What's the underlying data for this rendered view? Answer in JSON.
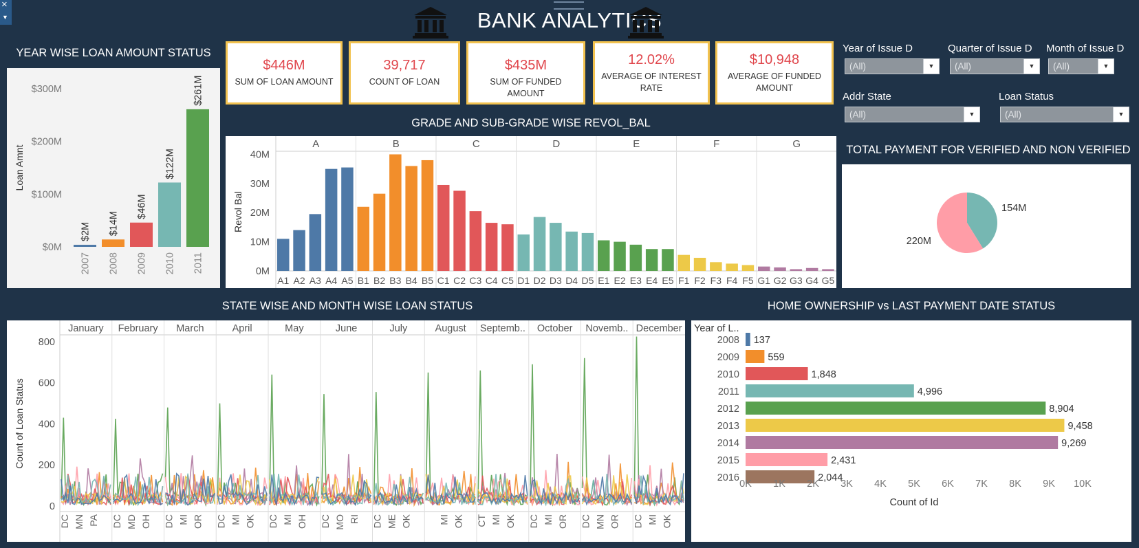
{
  "header": {
    "title": "BANK ANALYTICS"
  },
  "sections": {
    "year_loan": "YEAR WISE LOAN AMOUNT STATUS",
    "grade": "GRADE AND SUB-GRADE WISE REVOL_BAL",
    "verified": "TOTAL PAYMENT FOR VERIFIED AND NON VERIFIED",
    "state_month": "STATE WISE AND MONTH WISE LOAN STATUS",
    "home": "HOME OWNERSHIP vs LAST PAYMENT DATE STATUS"
  },
  "kpis": [
    {
      "value": "$446M",
      "label": "SUM OF LOAN AMOUNT"
    },
    {
      "value": "39,717",
      "label": "COUNT OF LOAN"
    },
    {
      "value": "$435M",
      "label": "SUM OF FUNDED AMOUNT"
    },
    {
      "value": "12.02%",
      "label": "AVERAGE OF INTEREST RATE"
    },
    {
      "value": "$10,948",
      "label": "AVERAGE OF FUNDED AMOUNT"
    }
  ],
  "filters": [
    {
      "label": "Year of Issue D",
      "value": "(All)"
    },
    {
      "label": "Quarter of Issue D",
      "value": "(All)"
    },
    {
      "label": "Month of Issue D",
      "value": "(All)"
    },
    {
      "label": "Addr State",
      "value": "(All)"
    },
    {
      "label": "Loan Status",
      "value": "(All)"
    }
  ],
  "colors": {
    "bg": "#1f3348",
    "blue": "#4e79a7",
    "orange": "#f28e2b",
    "red": "#e15759",
    "teal": "#76b7b2",
    "green": "#59a14f",
    "yellow": "#edc948",
    "purple": "#b07aa1",
    "pink": "#ff9da7",
    "brown": "#9c755f",
    "kpi_border": "#f2c24f",
    "kpi_value": "#e0464c"
  },
  "chart_data": [
    {
      "id": "year_loan",
      "type": "bar",
      "categories": [
        "2007",
        "2008",
        "2009",
        "2010",
        "2011"
      ],
      "values": [
        2,
        14,
        46,
        122,
        261
      ],
      "data_labels": [
        "$2M",
        "$14M",
        "$46M",
        "$122M",
        "$261M"
      ],
      "ylabel": "Loan Amnt",
      "y_ticks": [
        "$0M",
        "$100M",
        "$200M",
        "$300M"
      ],
      "ylim": [
        0,
        300
      ],
      "colors": [
        "#4e79a7",
        "#f28e2b",
        "#e15759",
        "#76b7b2",
        "#59a14f"
      ]
    },
    {
      "id": "grade",
      "type": "bar",
      "groups": [
        "A",
        "B",
        "C",
        "D",
        "E",
        "F",
        "G"
      ],
      "categories": [
        "A1",
        "A2",
        "A3",
        "A4",
        "A5",
        "B1",
        "B2",
        "B3",
        "B4",
        "B5",
        "C1",
        "C2",
        "C3",
        "C4",
        "C5",
        "D1",
        "D2",
        "D3",
        "D4",
        "D5",
        "E1",
        "E2",
        "E3",
        "E4",
        "E5",
        "F1",
        "F2",
        "F3",
        "F4",
        "F5",
        "G1",
        "G2",
        "G3",
        "G4",
        "G5"
      ],
      "values": [
        11,
        14,
        19.5,
        35,
        35.5,
        22,
        26.5,
        40,
        36,
        38,
        29.5,
        27.5,
        20.5,
        16.5,
        16,
        12.5,
        18.5,
        16.5,
        13.5,
        13,
        10.5,
        10,
        9,
        7.5,
        7.5,
        5.5,
        4.5,
        3,
        2.5,
        2,
        1.5,
        1.2,
        0.6,
        1,
        0.6
      ],
      "colors": [
        "#4e79a7",
        "#f28e2b",
        "#e15759",
        "#76b7b2",
        "#59a14f",
        "#edc948",
        "#b07aa1"
      ],
      "ylabel": "Revol Bal",
      "y_ticks": [
        "0M",
        "10M",
        "20M",
        "30M",
        "40M"
      ],
      "ylim": [
        0,
        42
      ]
    },
    {
      "id": "verified",
      "type": "pie",
      "values": [
        154,
        220
      ],
      "data_labels": [
        "154M",
        "220M"
      ],
      "colors": [
        "#76b7b2",
        "#ff9da7"
      ]
    },
    {
      "id": "state_month",
      "type": "line",
      "months": [
        "January",
        "February",
        "March",
        "April",
        "May",
        "June",
        "July",
        "August",
        "Septemb..",
        "October",
        "Novemb..",
        "December"
      ],
      "month_peaks": [
        430,
        425,
        480,
        500,
        640,
        545,
        555,
        650,
        660,
        690,
        720,
        825
      ],
      "state_labels": [
        [
          "DC",
          "MN",
          "PA"
        ],
        [
          "DC",
          "MD",
          "OH"
        ],
        [
          "DC",
          "MI",
          "OR"
        ],
        [
          "DC",
          "MI",
          "OK"
        ],
        [
          "DC",
          "MI",
          "OH"
        ],
        [
          "DC",
          "MO",
          "RI"
        ],
        [
          "DC",
          "ME",
          "OK"
        ],
        [
          "",
          "MI",
          "OK"
        ],
        [
          "CT",
          "MI",
          "OK"
        ],
        [
          "DC",
          "MI",
          "OR"
        ],
        [
          "DC",
          "MN",
          "OR"
        ],
        [
          "DC",
          "MI",
          "OK"
        ]
      ],
      "ylabel": "Count of Loan Status",
      "y_ticks": [
        "0",
        "200",
        "400",
        "600",
        "800"
      ],
      "ylim": [
        0,
        850
      ],
      "series_colors": [
        "#59a14f",
        "#f28e2b",
        "#b07aa1",
        "#ff9da7",
        "#e15759",
        "#edc948",
        "#76b7b2",
        "#4e79a7"
      ]
    },
    {
      "id": "home",
      "type": "bar",
      "orientation": "horizontal",
      "categories": [
        "2008",
        "2009",
        "2010",
        "2011",
        "2012",
        "2013",
        "2014",
        "2015",
        "2016"
      ],
      "values": [
        137,
        559,
        1848,
        4996,
        8904,
        9458,
        9269,
        2431,
        2044
      ],
      "data_labels": [
        "137",
        "559",
        "1,848",
        "4,996",
        "8,904",
        "9,458",
        "9,269",
        "2,431",
        "2,044"
      ],
      "colors": [
        "#4e79a7",
        "#f28e2b",
        "#e15759",
        "#76b7b2",
        "#59a14f",
        "#edc948",
        "#b07aa1",
        "#ff9da7",
        "#9c755f"
      ],
      "row_header": "Year of L..",
      "xlabel": "Count of Id",
      "x_ticks": [
        "0K",
        "1K",
        "2K",
        "3K",
        "4K",
        "5K",
        "6K",
        "7K",
        "8K",
        "9K",
        "10K"
      ],
      "xlim": [
        0,
        10000
      ]
    }
  ]
}
